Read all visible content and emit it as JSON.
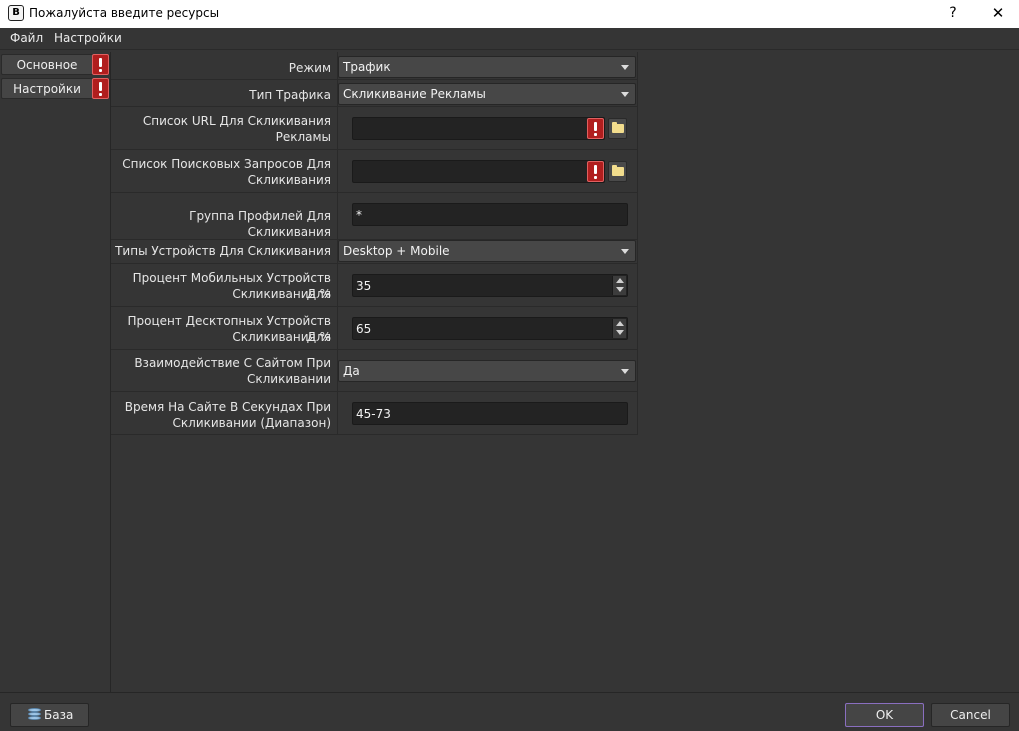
{
  "window": {
    "title": "Пожалуйста введите ресурсы",
    "help": "?",
    "close": "✕"
  },
  "menu": [
    "Файл",
    "Настройки"
  ],
  "sidebar": {
    "items": [
      {
        "label": "Основное",
        "warning": true
      },
      {
        "label": "Настройки",
        "warning": true
      }
    ]
  },
  "form": {
    "mode": {
      "label": "Режим",
      "value": "Трафик"
    },
    "traffic_type": {
      "label": "Тип Трафика",
      "value": "Скликивание Рекламы"
    },
    "url_list": {
      "label1": "Список URL Для Скликивания",
      "label2": "Рекламы",
      "value": ""
    },
    "search_queries": {
      "label1": "Список Поисковых Запросов Для",
      "label2": "Скликивания",
      "value": ""
    },
    "profile_group": {
      "label": "Группа Профилей Для Скликивания",
      "value": "*"
    },
    "device_types": {
      "label": "Типы Устройств Для Скликивания",
      "value": "Desktop + Mobile"
    },
    "mobile_percent": {
      "label1": "Процент Мобильных Устройств Для",
      "label2": "Скликивания %",
      "value": "35"
    },
    "desktop_percent": {
      "label1": "Процент Десктопных Устройств Для",
      "label2": "Скликивания %",
      "value": "65"
    },
    "site_interaction": {
      "label1": "Взаимодействие С Сайтом При",
      "label2": "Скликивании",
      "value": "Да"
    },
    "time_on_site": {
      "label1": "Время На Сайте В Секундах При",
      "label2": "Скликивании (Диапазон)",
      "value": "45-73"
    }
  },
  "footer": {
    "base_button": "База",
    "ok_button": "OK",
    "cancel_button": "Cancel"
  },
  "colors": {
    "warning": "#b01e1e",
    "ok_border": "#8a6fc0",
    "background": "#353535"
  }
}
